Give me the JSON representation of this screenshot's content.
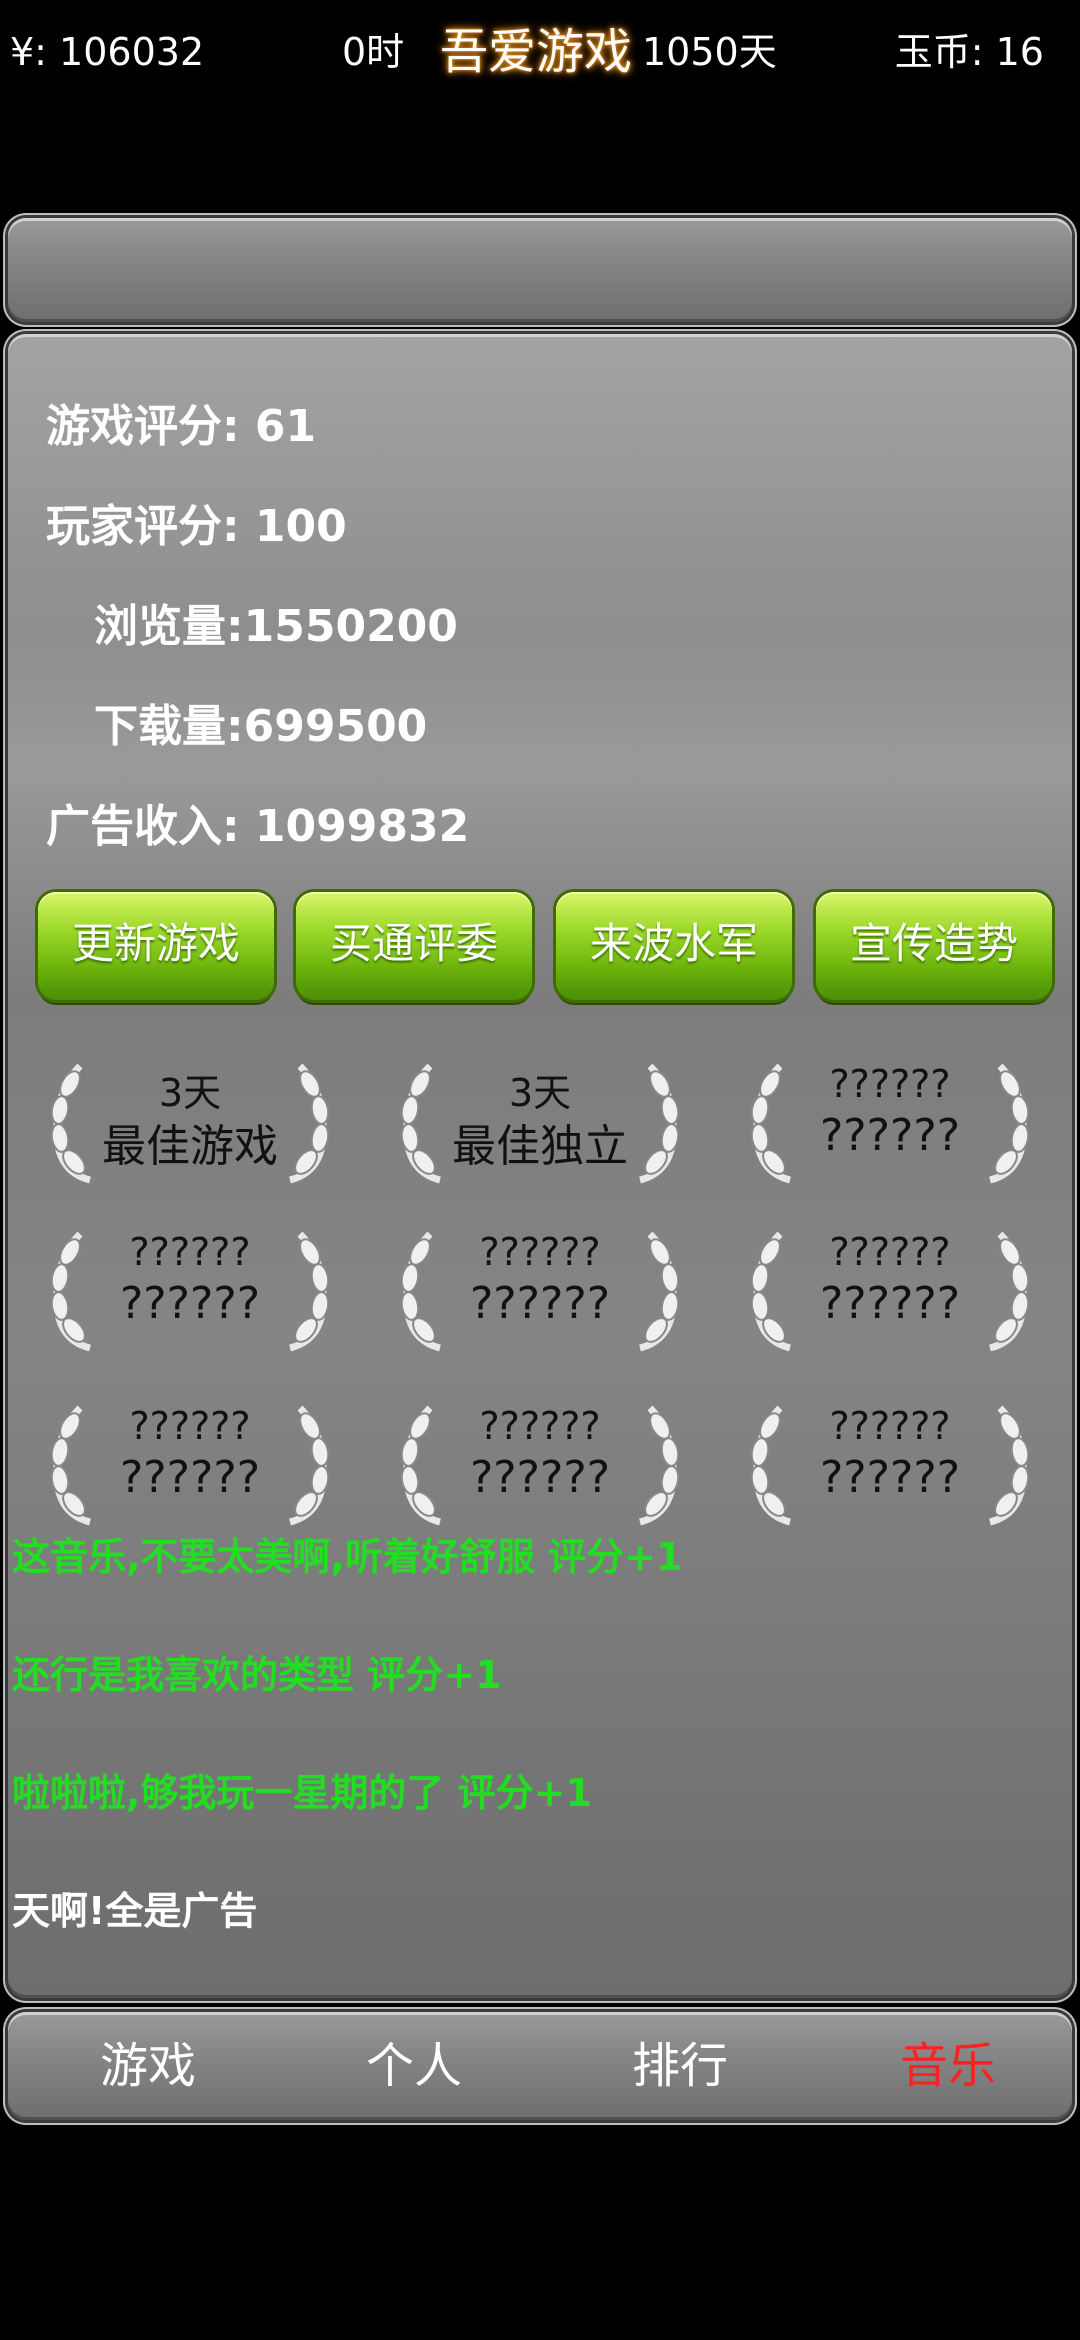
{
  "header": {
    "money": "¥: 106032",
    "hour": "0时",
    "game_title": "吾爱游戏",
    "days": "1050天",
    "coins": "玉币: 16"
  },
  "stats": [
    {
      "label": "游戏评分:",
      "value": " 61"
    },
    {
      "label": "玩家评分:",
      "value": " 100"
    },
    {
      "label": "浏览量:",
      "value": "1550200"
    },
    {
      "label": "下载量:",
      "value": "699500"
    },
    {
      "label": "广告收入:",
      "value": " 1099832"
    }
  ],
  "actions": {
    "update": "更新游戏",
    "bribe": "买通评委",
    "army": "来波水军",
    "promo": "宣传造势"
  },
  "awards": [
    {
      "line1": "3天",
      "line2": "最佳游戏"
    },
    {
      "line1": "3天",
      "line2": "最佳独立"
    },
    {
      "line1": "??????",
      "line2": "??????"
    },
    {
      "line1": "??????",
      "line2": "??????"
    },
    {
      "line1": "??????",
      "line2": "??????"
    },
    {
      "line1": "??????",
      "line2": "??????"
    },
    {
      "line1": "??????",
      "line2": "??????"
    },
    {
      "line1": "??????",
      "line2": "??????"
    },
    {
      "line1": "??????",
      "line2": "??????"
    }
  ],
  "comments": [
    {
      "text": "这音乐,不要太美啊,听着好舒服    评分+1",
      "color": "#22dd22"
    },
    {
      "text": "还行是我喜欢的类型    评分+1",
      "color": "#22dd22"
    },
    {
      "text": "啦啦啦,够我玩一星期的了    评分+1",
      "color": "#22dd22"
    },
    {
      "text": "天啊!全是广告",
      "color": "#ffffff"
    }
  ],
  "nav": {
    "game": "游戏",
    "personal": "个人",
    "rank": "排行",
    "music": "音乐",
    "active_color": "#ff2020"
  },
  "award_icon": "silver-laurel-icon"
}
